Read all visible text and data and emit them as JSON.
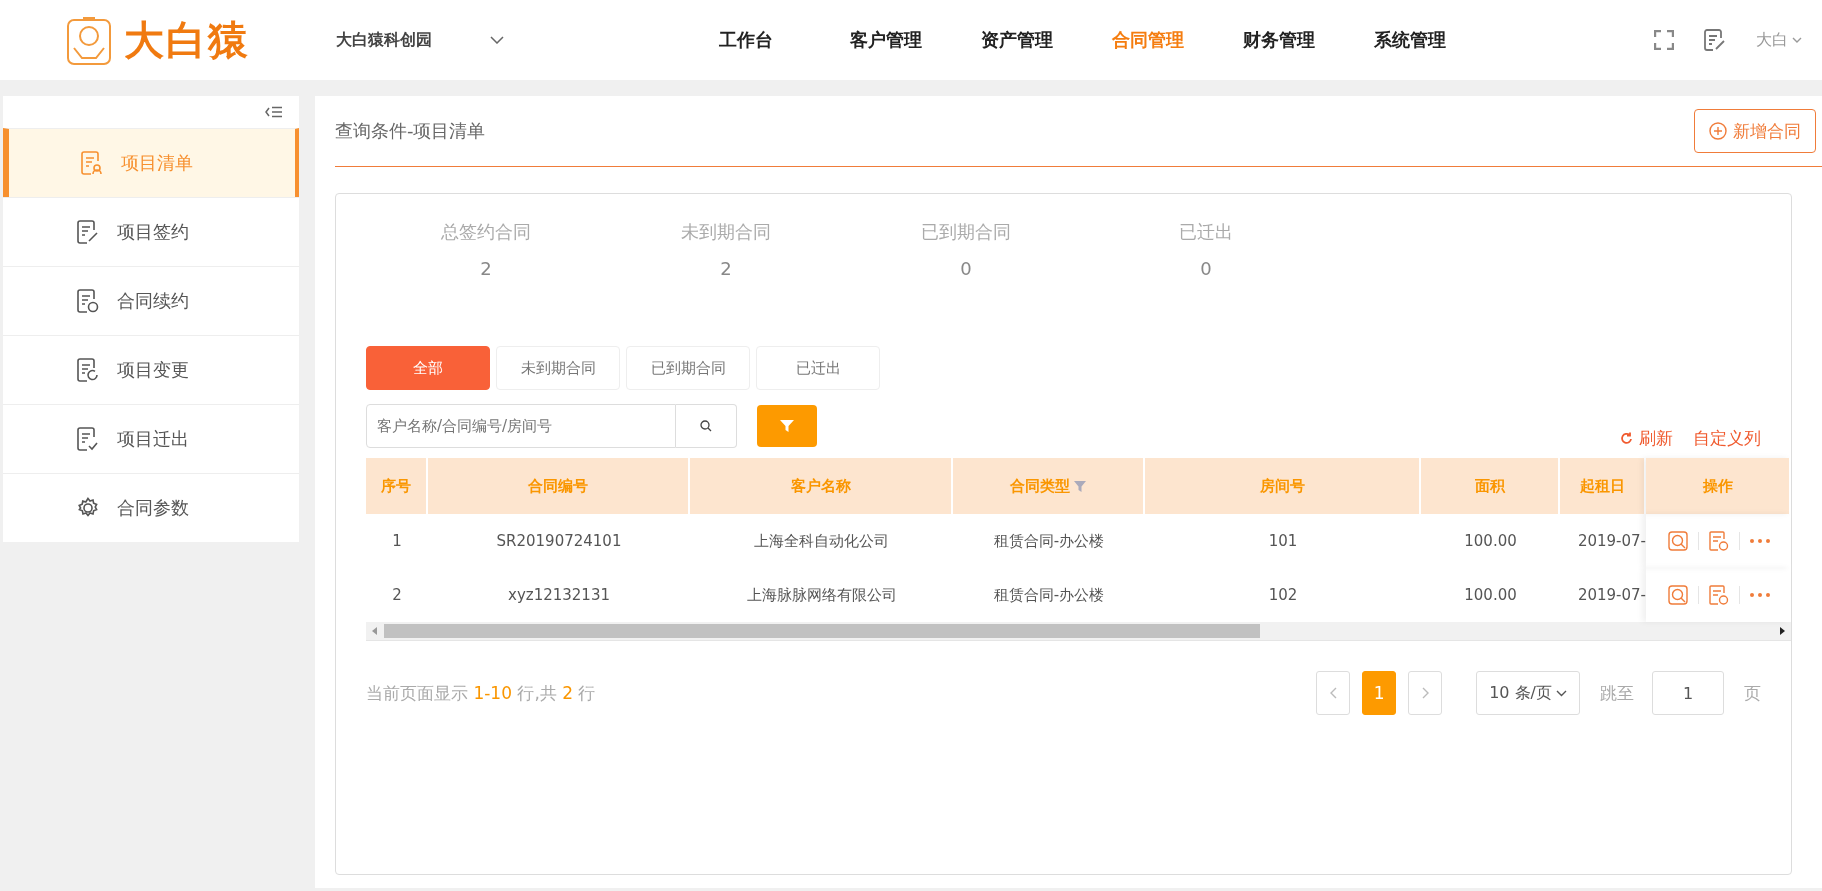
{
  "header": {
    "logo_text": "大白猿",
    "project": "大白猿科创园",
    "nav": [
      {
        "label": "工作台",
        "selected": false
      },
      {
        "label": "客户管理",
        "selected": false
      },
      {
        "label": "资产管理",
        "selected": false
      },
      {
        "label": "合同管理",
        "selected": true
      },
      {
        "label": "财务管理",
        "selected": false
      },
      {
        "label": "系统管理",
        "selected": false
      }
    ],
    "user": "大白"
  },
  "sidebar": {
    "items": [
      {
        "label": "项目清单",
        "selected": true
      },
      {
        "label": "项目签约",
        "selected": false
      },
      {
        "label": "合同续约",
        "selected": false
      },
      {
        "label": "项目变更",
        "selected": false
      },
      {
        "label": "项目迁出",
        "selected": false
      },
      {
        "label": "合同参数",
        "selected": false
      }
    ]
  },
  "panel": {
    "title": "查询条件-项目清单",
    "add_button": "新增合同"
  },
  "stats": [
    {
      "label": "总签约合同",
      "value": "2"
    },
    {
      "label": "未到期合同",
      "value": "2"
    },
    {
      "label": "已到期合同",
      "value": "0"
    },
    {
      "label": "已迁出",
      "value": "0"
    }
  ],
  "filter_tabs": [
    {
      "label": "全部",
      "selected": true
    },
    {
      "label": "未到期合同",
      "selected": false
    },
    {
      "label": "已到期合同",
      "selected": false
    },
    {
      "label": "已迁出",
      "selected": false
    }
  ],
  "search": {
    "placeholder": "客户名称/合同编号/房间号"
  },
  "toolbar": {
    "refresh": "刷新",
    "custom_columns": "自定义列"
  },
  "table": {
    "columns": [
      {
        "label": "序号",
        "filterable": false
      },
      {
        "label": "合同编号",
        "filterable": false
      },
      {
        "label": "客户名称",
        "filterable": false
      },
      {
        "label": "合同类型",
        "filterable": true
      },
      {
        "label": "房间号",
        "filterable": false
      },
      {
        "label": "面积",
        "filterable": false
      },
      {
        "label": "起租日",
        "filterable": false
      },
      {
        "label": "操作",
        "filterable": false
      }
    ],
    "rows": [
      [
        "1",
        "SR20190724101",
        "上海全科自动化公司",
        "租赁合同-办公楼",
        "101",
        "100.00",
        "2019-07-"
      ],
      [
        "2",
        "xyz12132131",
        "上海脉脉网络有限公司",
        "租赁合同-办公楼",
        "102",
        "100.00",
        "2019-07-"
      ]
    ]
  },
  "pagination": {
    "summary": "当前页面显示 **1-10** 行,共 **2** 行",
    "pages": [
      {
        "label": "1",
        "selected": true
      }
    ],
    "page_size": "10 条/页",
    "jump_label": "跳至",
    "jump_value": "1",
    "page_suffix": "页"
  }
}
